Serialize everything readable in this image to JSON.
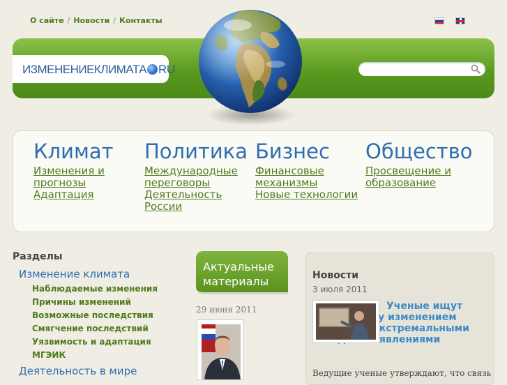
{
  "topnav": {
    "about": "О сайте",
    "news": "Новости",
    "contacts": "Контакты",
    "separator": "/"
  },
  "languages": [
    "ru",
    "en"
  ],
  "logo": {
    "prefix": "ИЗМЕНЕНИЕКЛИМАТА",
    "suffix": "RU"
  },
  "search": {
    "placeholder": "",
    "value": ""
  },
  "categories": [
    {
      "title": "Климат",
      "links": [
        "Изменения и",
        "прогнозы",
        "Адаптация"
      ]
    },
    {
      "title": "Политика",
      "links": [
        "Международные",
        "переговоры",
        "Деятельность",
        "России"
      ]
    },
    {
      "title": "Бизнес",
      "links": [
        "Финансовые",
        "механизмы",
        "Новые технологии"
      ]
    },
    {
      "title": "Общество",
      "links": [
        "Просвещение и",
        "образование"
      ]
    }
  ],
  "sections": {
    "title": "Разделы",
    "main1": "Изменение климата",
    "sub": [
      "Наблюдаемые изменения",
      "Причины изменений",
      "Возможные последствия",
      "Смягчение последствий",
      "Уязвимость и адаптация",
      "МГЭИК"
    ],
    "main2": "Деятельность в мире"
  },
  "aktual": {
    "title": "Актуальные материалы",
    "date": "29 июня 2011"
  },
  "news": {
    "title": "Новости",
    "date": "3 июля 2011",
    "headline": "Ученые ищут связь между изменением климата и экстремальными погодными явлениями",
    "lead": "Ведущие ученые утверждают, что связь"
  },
  "colors": {
    "accent_green": "#5a9a1f",
    "link_blue": "#2e6db0",
    "bg": "#f0eee4"
  }
}
